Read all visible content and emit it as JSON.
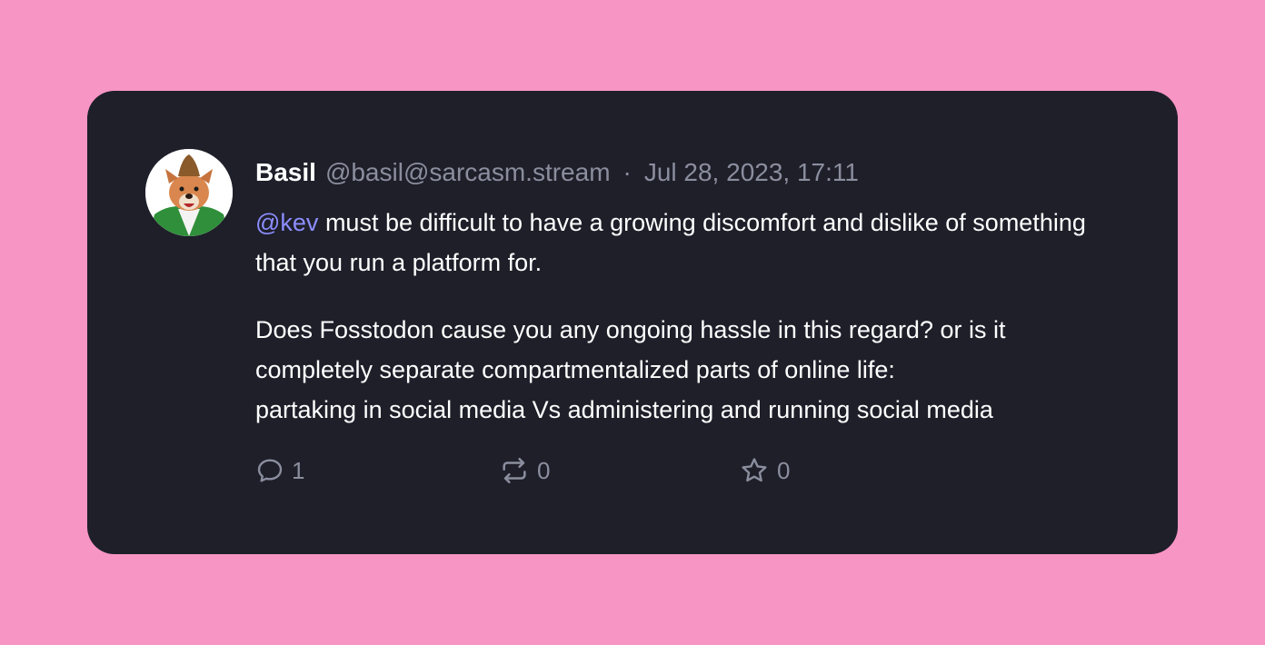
{
  "post": {
    "author": {
      "display_name": "Basil",
      "handle": "@basil@sarcasm.stream"
    },
    "separator": "·",
    "date": "Jul 28, 2023, 17:11",
    "paragraph1": {
      "mention": "@kev",
      "text": " must be difficult to have a growing discomfort and dislike of something that you run a platform for."
    },
    "paragraph2": {
      "line1": "Does Fosstodon cause you any ongoing hassle in this regard? or is it",
      "line2": "completely separate compartmentalized parts of online life:",
      "line3": "partaking in social media Vs administering and running social media"
    },
    "actions": {
      "replies": "1",
      "boosts": "0",
      "favourites": "0"
    }
  },
  "icons": {
    "reply": "speech-bubble-icon",
    "boost": "repost-arrows-icon",
    "favourite": "star-icon"
  },
  "colors": {
    "background": "#f795c5",
    "card": "#1e1f29",
    "mention": "#8c8dff",
    "muted": "#8b8e9e"
  }
}
